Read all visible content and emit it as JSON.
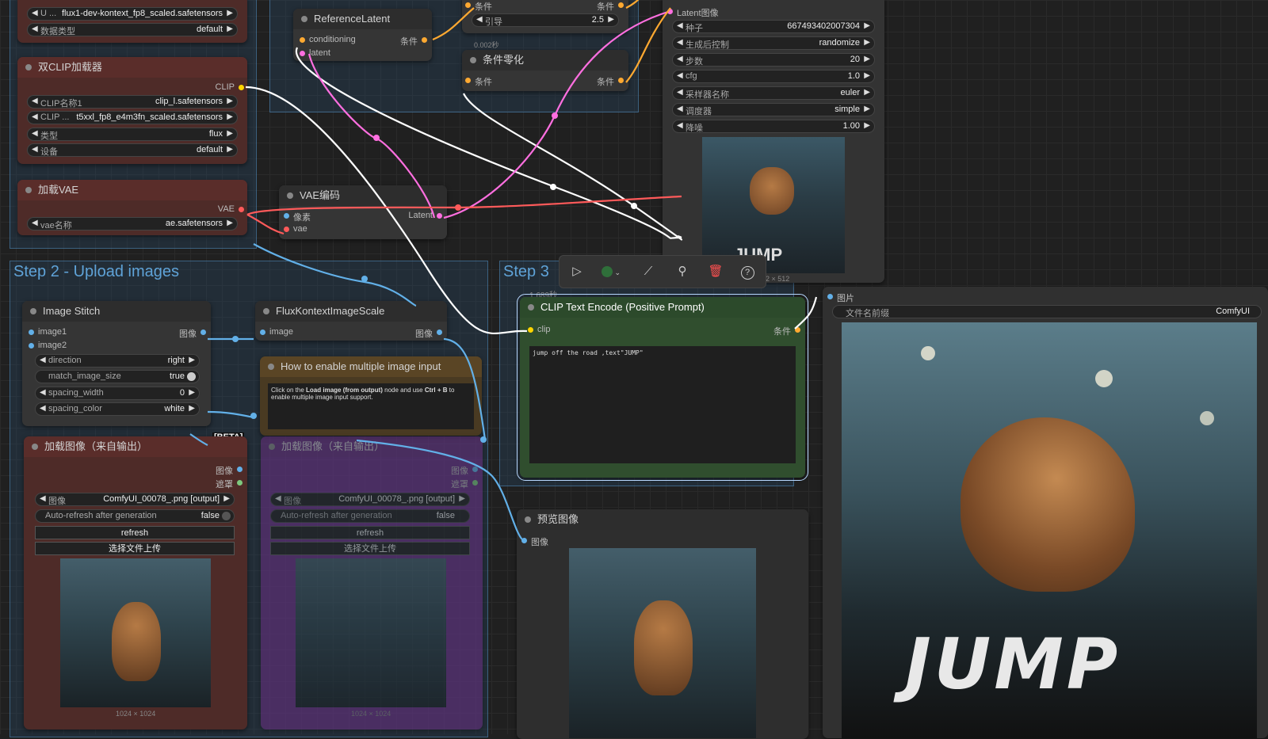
{
  "groups": {
    "step2_title": "Step 2 - Upload images",
    "step3_title": "Step 3"
  },
  "top_left_node": {
    "unet_label": "U ... ",
    "unet_value": "flux1-dev-kontext_fp8_scaled.safetensors",
    "dtype_label": "数据类型",
    "dtype_value": "default"
  },
  "dual_clip": {
    "title": "双CLIP加载器",
    "output": "CLIP",
    "clip1_label": "CLIP名称1",
    "clip1_value": "clip_l.safetensors",
    "clip2_label": "CLIP ...",
    "clip2_value": "t5xxl_fp8_e4m3fn_scaled.safetensors",
    "type_label": "类型",
    "type_value": "flux",
    "device_label": "设备",
    "device_value": "default"
  },
  "load_vae": {
    "title": "加载VAE",
    "output": "VAE",
    "name_label": "vae名称",
    "name_value": "ae.safetensors"
  },
  "reference_latent": {
    "title": "ReferenceLatent",
    "in1": "conditioning",
    "in2": "latent",
    "out": "条件"
  },
  "guidance": {
    "port_in": "条件",
    "port_out": "条件",
    "label": "引导",
    "value": "2.5",
    "timing": "0.002秒"
  },
  "cond_zero": {
    "title": "条件零化",
    "in": "条件",
    "out": "条件"
  },
  "vae_encode": {
    "title": "VAE编码",
    "in1": "像素",
    "in2": "vae",
    "out": "Latent"
  },
  "ksampler": {
    "latent_in": "Latent图像",
    "seed_label": "种子",
    "seed_value": "667493402007304",
    "ctrl_label": "生成后控制",
    "ctrl_value": "randomize",
    "steps_label": "步数",
    "steps_value": "20",
    "cfg_label": "cfg",
    "cfg_value": "1.0",
    "sampler_label": "采样器名称",
    "sampler_value": "euler",
    "sched_label": "调度器",
    "sched_value": "simple",
    "denoise_label": "降噪",
    "denoise_value": "1.00",
    "image_size": "2 × 512"
  },
  "toolbar": {
    "run_icon": "play-icon",
    "color_icon": "color-dot-icon",
    "bypass_icon": "bypass-icon",
    "pin_icon": "pin-icon",
    "delete_icon": "trash-icon",
    "help_icon": "help-icon"
  },
  "image_stitch": {
    "title": "Image Stitch",
    "in1": "image1",
    "in2": "image2",
    "out": "图像",
    "direction_label": "direction",
    "direction_value": "right",
    "match_label": "match_image_size",
    "match_value": "true",
    "spacing_label": "spacing_width",
    "spacing_value": "0",
    "color_label": "spacing_color",
    "color_value": "white",
    "badge": "[BETA]"
  },
  "flux_scale": {
    "title": "FluxKontextImageScale",
    "in": "image",
    "out": "图像"
  },
  "note": {
    "title": "How to enable multiple image input",
    "text_a": "Click on the ",
    "text_b": "Load image (from output)",
    "text_c": " node and use ",
    "text_d": "Ctrl + B",
    "text_e": " to enable multiple image input support.",
    "badge": "[BETA]"
  },
  "load_image_1": {
    "title": "加载图像（来自输出）",
    "out1": "图像",
    "out2": "遮罩",
    "image_label": "图像",
    "image_value": "ComfyUI_00078_.png [output]",
    "auto_label": "Auto-refresh after generation",
    "auto_value": "false",
    "refresh": "refresh",
    "upload": "选择文件上传",
    "size": "1024 × 1024"
  },
  "load_image_2": {
    "title": "加载图像（来自输出）",
    "out1": "图像",
    "out2": "遮罩",
    "image_label": "图像",
    "image_value": "ComfyUI_00078_.png [output]",
    "auto_label": "Auto-refresh after generation",
    "auto_value": "false",
    "refresh": "refresh",
    "upload": "选择文件上传",
    "size": "1024 × 1024"
  },
  "clip_text": {
    "timing": "1.689秒",
    "title": "CLIP Text Encode (Positive Prompt)",
    "in": "clip",
    "out": "条件",
    "prompt": "jump off the road ,text\"JUMP\""
  },
  "preview": {
    "title": "预览图像",
    "in": "图像"
  },
  "save_image": {
    "in": "图片",
    "prefix_label": "文件名前缀",
    "prefix_value": "ComfyUI",
    "jump_text": "JUMP"
  },
  "colors": {
    "clip_wire": "#ffffff",
    "latent_wire": "#ff6fe0",
    "vae_wire": "#ff5a5a",
    "image_wire": "#62b0e8",
    "cond_wire": "#ffa931"
  }
}
